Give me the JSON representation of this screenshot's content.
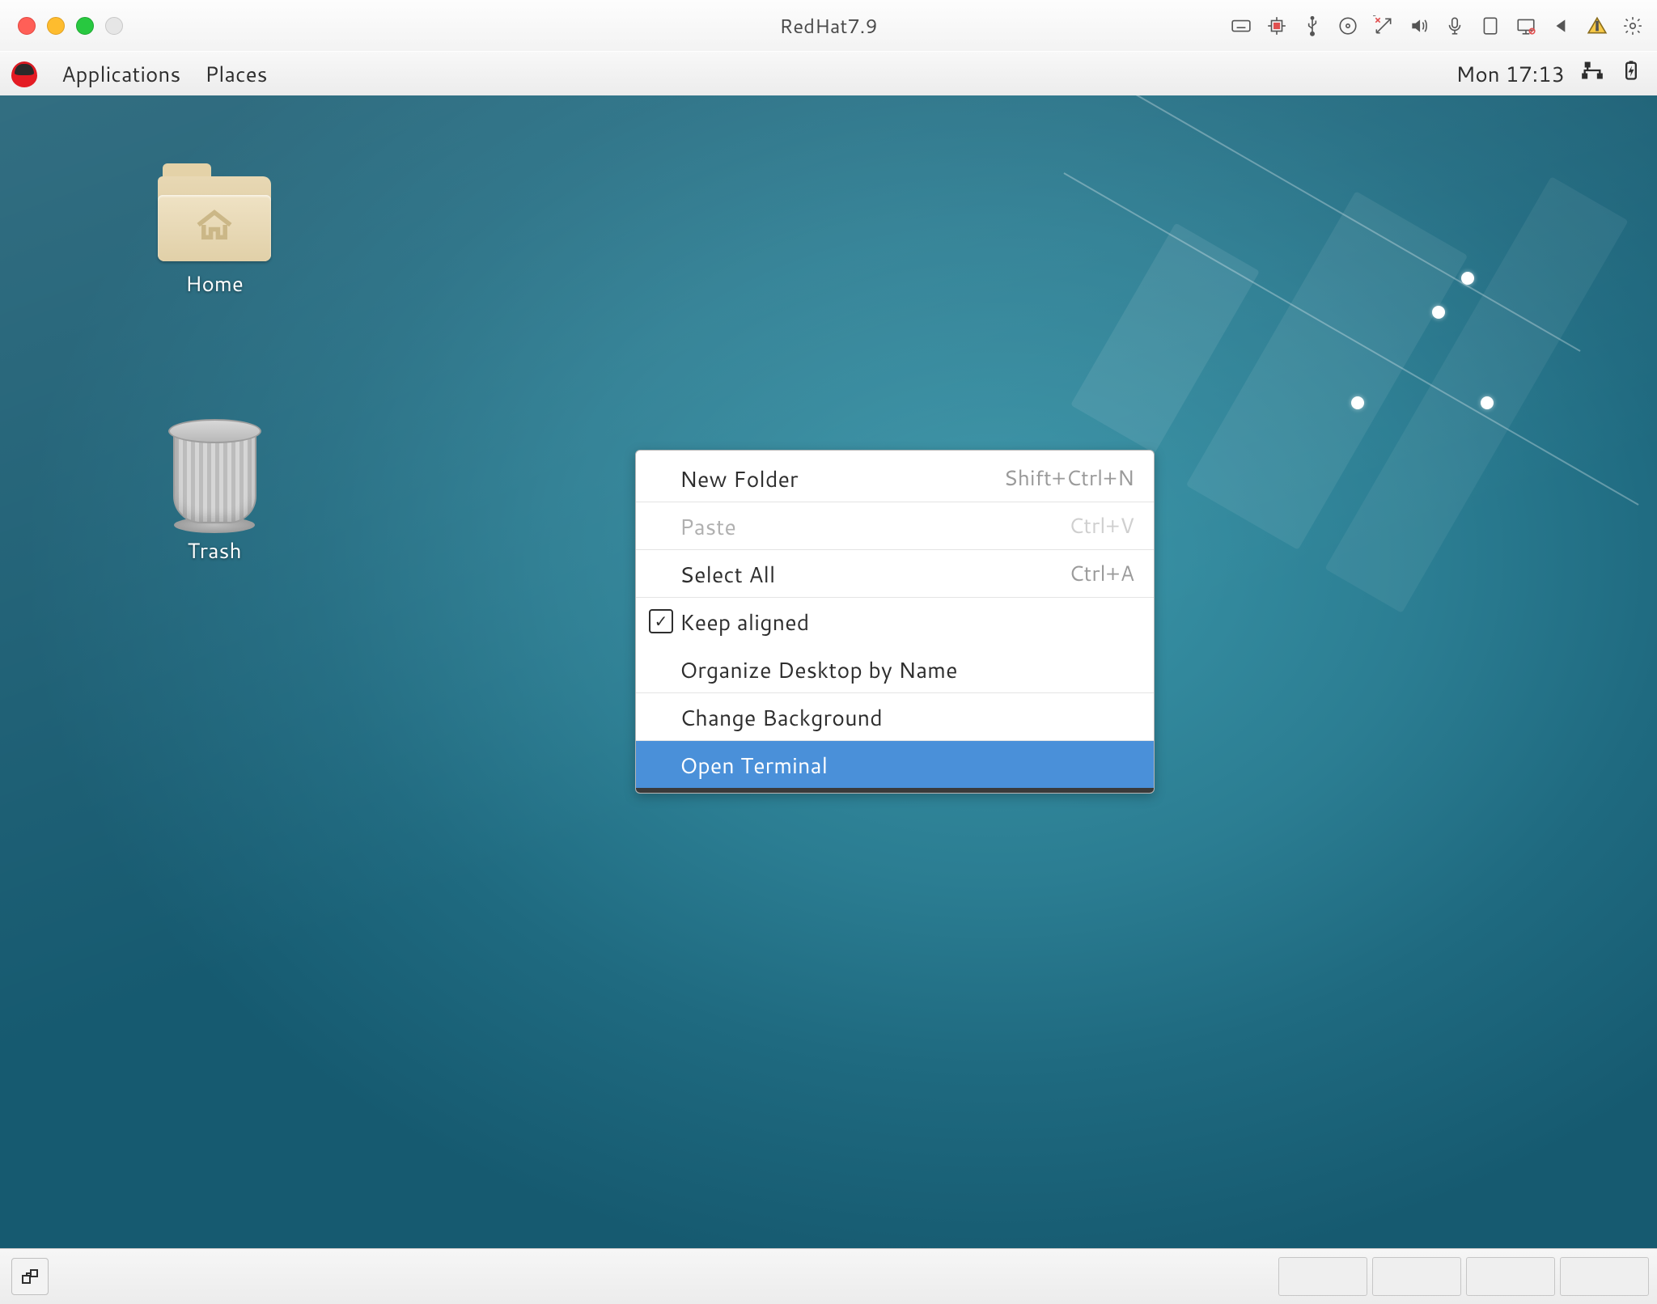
{
  "host": {
    "title": "RedHat7.9",
    "tray_icons": [
      "keyboard-icon",
      "cpu-icon",
      "usb-icon",
      "disc-icon",
      "network-arrow-icon",
      "sound-icon",
      "microphone-icon",
      "tablet-icon",
      "display-icon",
      "left-triangle-icon",
      "warning-icon",
      "gear-icon"
    ]
  },
  "panel": {
    "applications": "Applications",
    "places": "Places",
    "clock": "Mon 17:13"
  },
  "desktop_icons": {
    "home": "Home",
    "trash": "Trash"
  },
  "context_menu": {
    "new_folder": {
      "label": "New Folder",
      "accel": "Shift+Ctrl+N"
    },
    "paste": {
      "label": "Paste",
      "accel": "Ctrl+V"
    },
    "select_all": {
      "label": "Select All",
      "accel": "Ctrl+A"
    },
    "keep_aligned": {
      "label": "Keep aligned",
      "checked": true
    },
    "organize": {
      "label": "Organize Desktop by Name"
    },
    "change_background": {
      "label": "Change Background"
    },
    "open_terminal": {
      "label": "Open Terminal"
    }
  }
}
